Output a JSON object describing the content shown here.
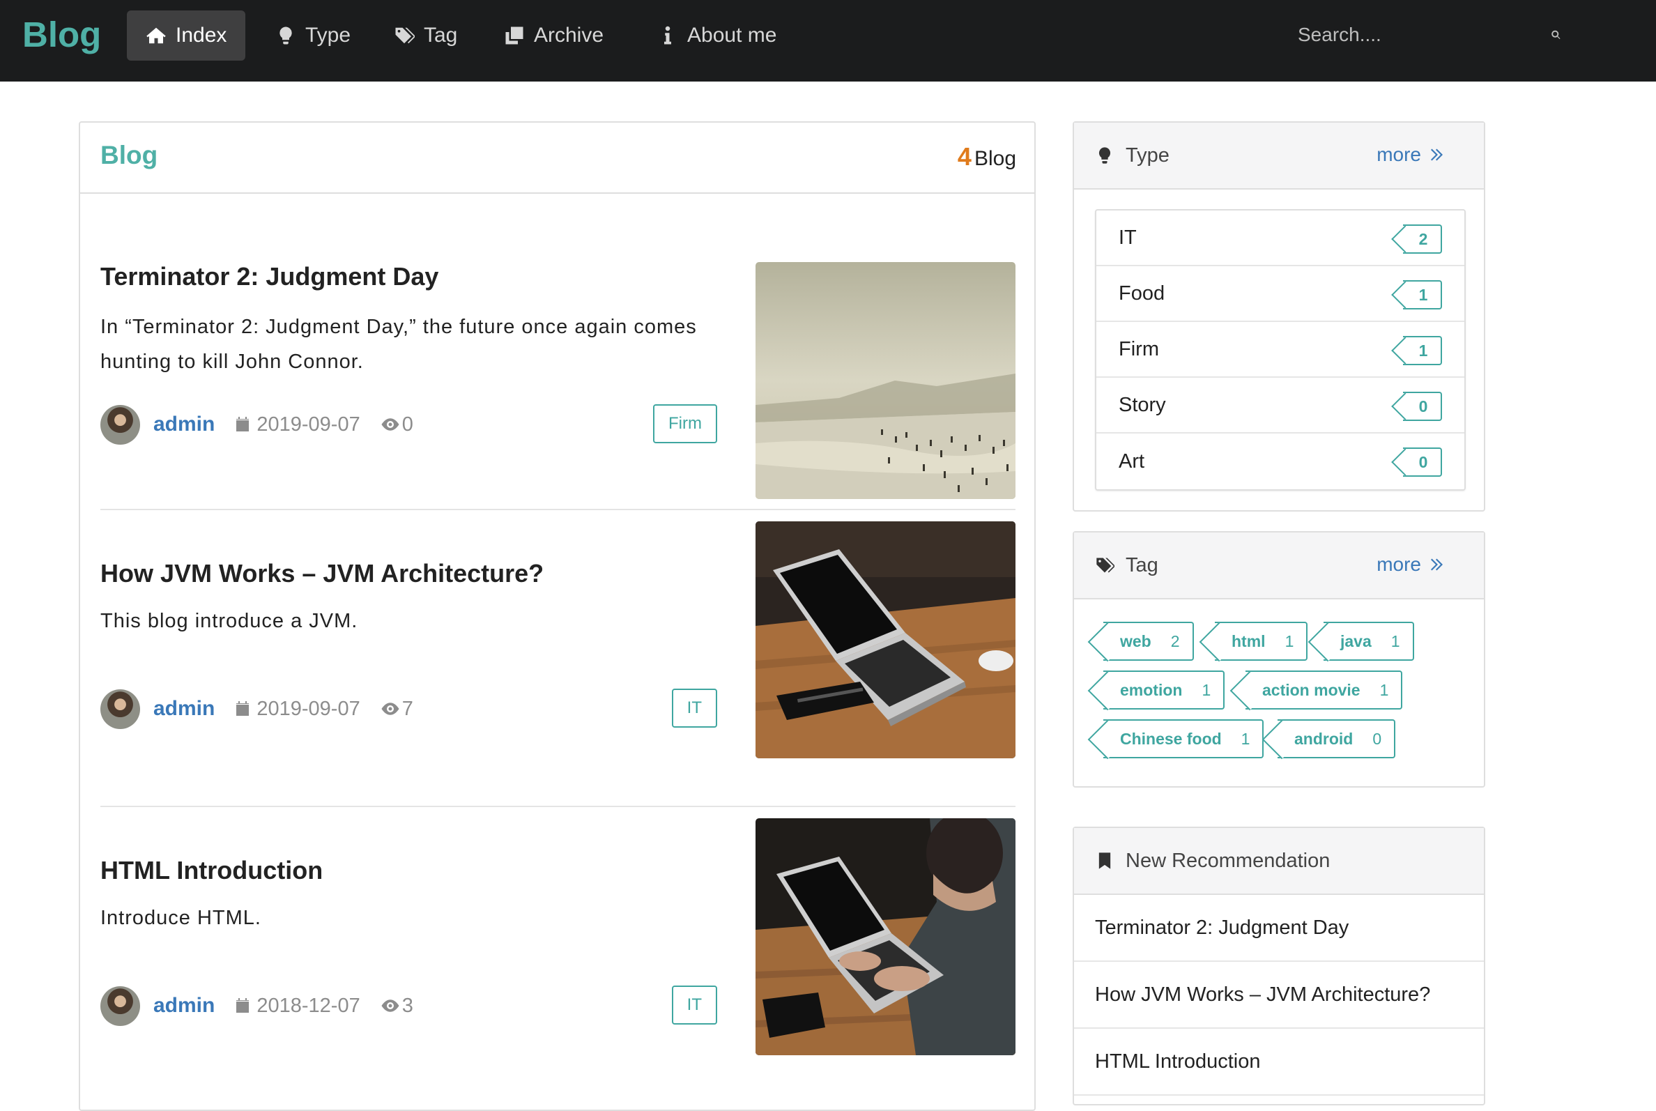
{
  "nav": {
    "brand": "Blog",
    "items": [
      {
        "label": "Index",
        "icon": "home-icon"
      },
      {
        "label": "Type",
        "icon": "lightbulb-icon"
      },
      {
        "label": "Tag",
        "icon": "tags-icon"
      },
      {
        "label": "Archive",
        "icon": "clone-icon"
      },
      {
        "label": "About me",
        "icon": "info-icon"
      }
    ],
    "search_placeholder": "Search...."
  },
  "main": {
    "title": "Blog",
    "count": "4",
    "count_label": "Blog",
    "posts": [
      {
        "title": "Terminator 2: Judgment Day",
        "description": "In “Terminator 2: Judgment Day,” the future once again comes hunting to kill John Connor.",
        "author": "admin",
        "date": "2019-09-07",
        "views": "0",
        "tag": "Firm"
      },
      {
        "title": "How JVM Works – JVM Architecture?",
        "description": "This blog introduce a JVM.",
        "author": "admin",
        "date": "2019-09-07",
        "views": "7",
        "tag": "IT"
      },
      {
        "title": "HTML Introduction",
        "description": "Introduce HTML.",
        "author": "admin",
        "date": "2018-12-07",
        "views": "3",
        "tag": "IT"
      }
    ]
  },
  "sidebar": {
    "types": {
      "title": "Type",
      "more": "more",
      "items": [
        {
          "name": "IT",
          "count": "2"
        },
        {
          "name": "Food",
          "count": "1"
        },
        {
          "name": "Firm",
          "count": "1"
        },
        {
          "name": "Story",
          "count": "0"
        },
        {
          "name": "Art",
          "count": "0"
        }
      ]
    },
    "tags": {
      "title": "Tag",
      "more": "more",
      "items": [
        {
          "name": "web",
          "count": "2"
        },
        {
          "name": "html",
          "count": "1"
        },
        {
          "name": "java",
          "count": "1"
        },
        {
          "name": "emotion",
          "count": "1"
        },
        {
          "name": "action movie",
          "count": "1"
        },
        {
          "name": "Chinese food",
          "count": "1"
        },
        {
          "name": "android",
          "count": "0"
        }
      ]
    },
    "recommend": {
      "title": "New Recommendation",
      "items": [
        "Terminator 2: Judgment Day",
        "How JVM Works – JVM Architecture?",
        "HTML Introduction"
      ]
    }
  },
  "colors": {
    "brand": "#4fb0a6",
    "accent_count": "#e07b1c",
    "link": "#3a78b8",
    "tag": "#3fa6a0",
    "nav_bg": "#1b1c1d"
  }
}
